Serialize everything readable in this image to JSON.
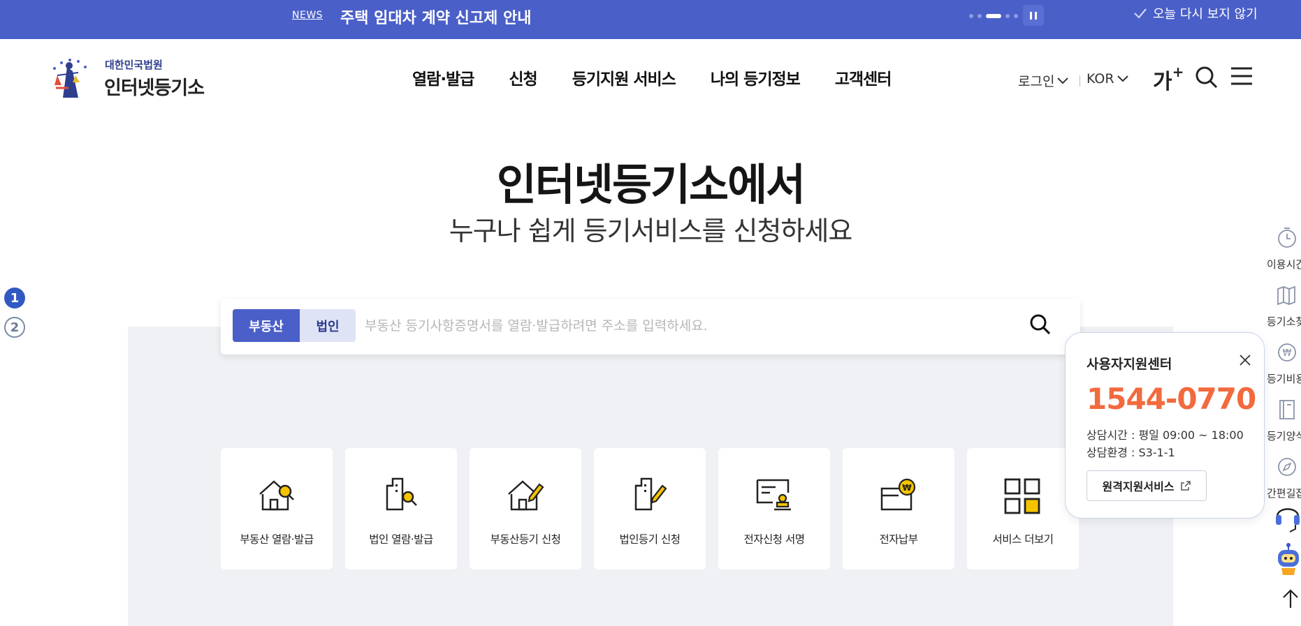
{
  "newsbar": {
    "tag": "NEWS",
    "headline": "주택 임대차 계약 신고제 안내",
    "dismiss_label": "오늘 다시 보지 않기",
    "bg_color": "#4a5fc8"
  },
  "header": {
    "logo_top": "대한민국법원",
    "logo_main": "인터넷등기소",
    "nav": [
      "열람·발급",
      "신청",
      "등기지원 서비스",
      "나의 등기정보",
      "고객센터"
    ],
    "login_label": "로그인",
    "lang_label": "KOR",
    "font_size_label": "가",
    "font_size_plus": "+"
  },
  "hero": {
    "title": "인터넷등기소에서",
    "subtitle": "누구나 쉽게 등기서비스를 신청하세요"
  },
  "pager": [
    "1",
    "2"
  ],
  "search": {
    "tab_real_estate": "부동산",
    "tab_corporation": "법인",
    "placeholder": "부동산 등기사항증명서를 열람·발급하려면 주소를 입력하세요."
  },
  "services": [
    {
      "label": "부동산 열람·발급",
      "icon": "house-search-icon"
    },
    {
      "label": "법인 열람·발급",
      "icon": "building-search-icon"
    },
    {
      "label": "부동산등기 신청",
      "icon": "house-pen-icon"
    },
    {
      "label": "법인등기 신청",
      "icon": "building-pen-icon"
    },
    {
      "label": "전자신청 서명",
      "icon": "document-stamp-icon"
    },
    {
      "label": "전자납부",
      "icon": "wallet-won-icon"
    },
    {
      "label": "서비스 더보기",
      "icon": "grid-icon"
    }
  ],
  "support": {
    "title": "사용자지원센터",
    "phone": "1544-0770",
    "hours": "상담시간 : 평일 09:00 ~ 18:00",
    "env": "상담환경 : S3-1-1",
    "remote_label": "원격지원서비스",
    "accent": "#f26a3d"
  },
  "quick_menu": [
    "이용시간",
    "등기소찾",
    "등기비용",
    "등기양식",
    "간편길잡"
  ]
}
